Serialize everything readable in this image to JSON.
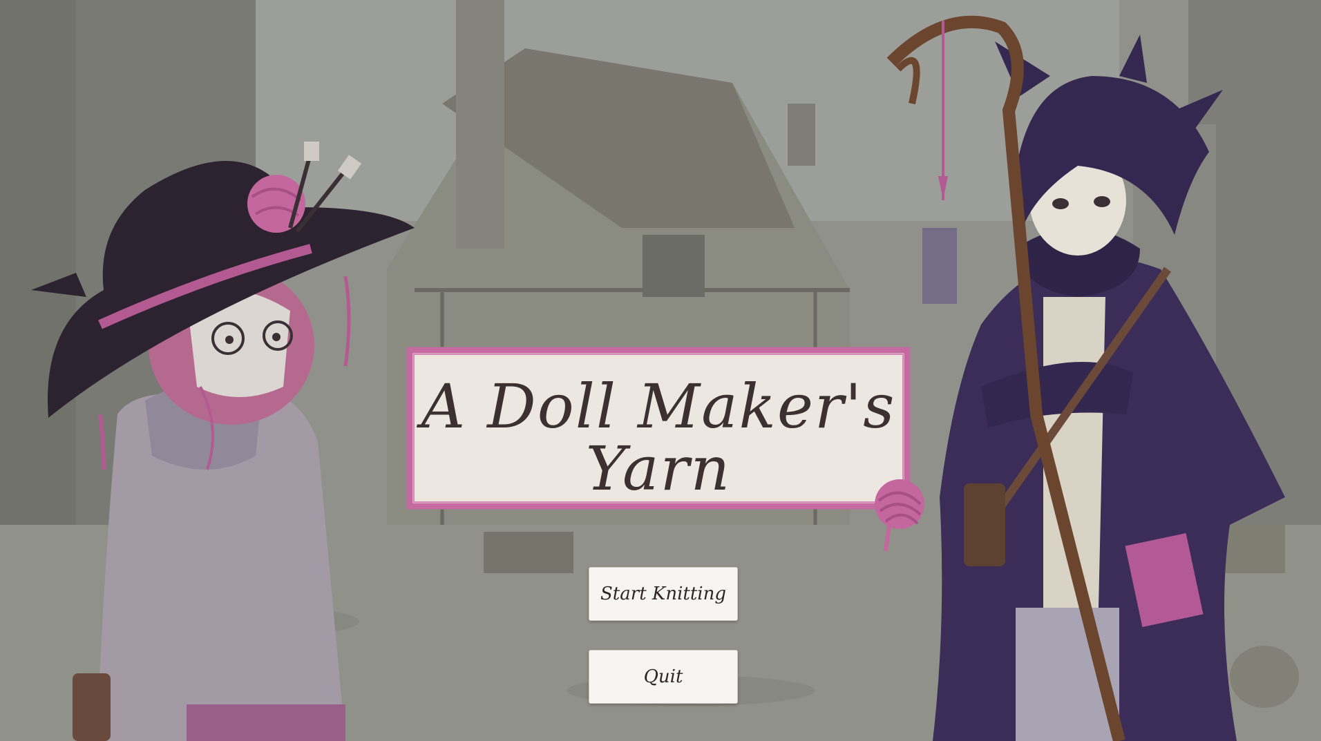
{
  "title": {
    "line1": "A Doll Maker's",
    "line2": "Yarn"
  },
  "menu": {
    "start_label": "Start Knitting",
    "quit_label": "Quit"
  },
  "colors": {
    "paper": "#ece8e1",
    "yarn_pink": "#c46aa0",
    "title_ink": "#3d3030",
    "robe_purple": "#3a2a55"
  },
  "icons": [
    "yarn-ball-icon"
  ]
}
